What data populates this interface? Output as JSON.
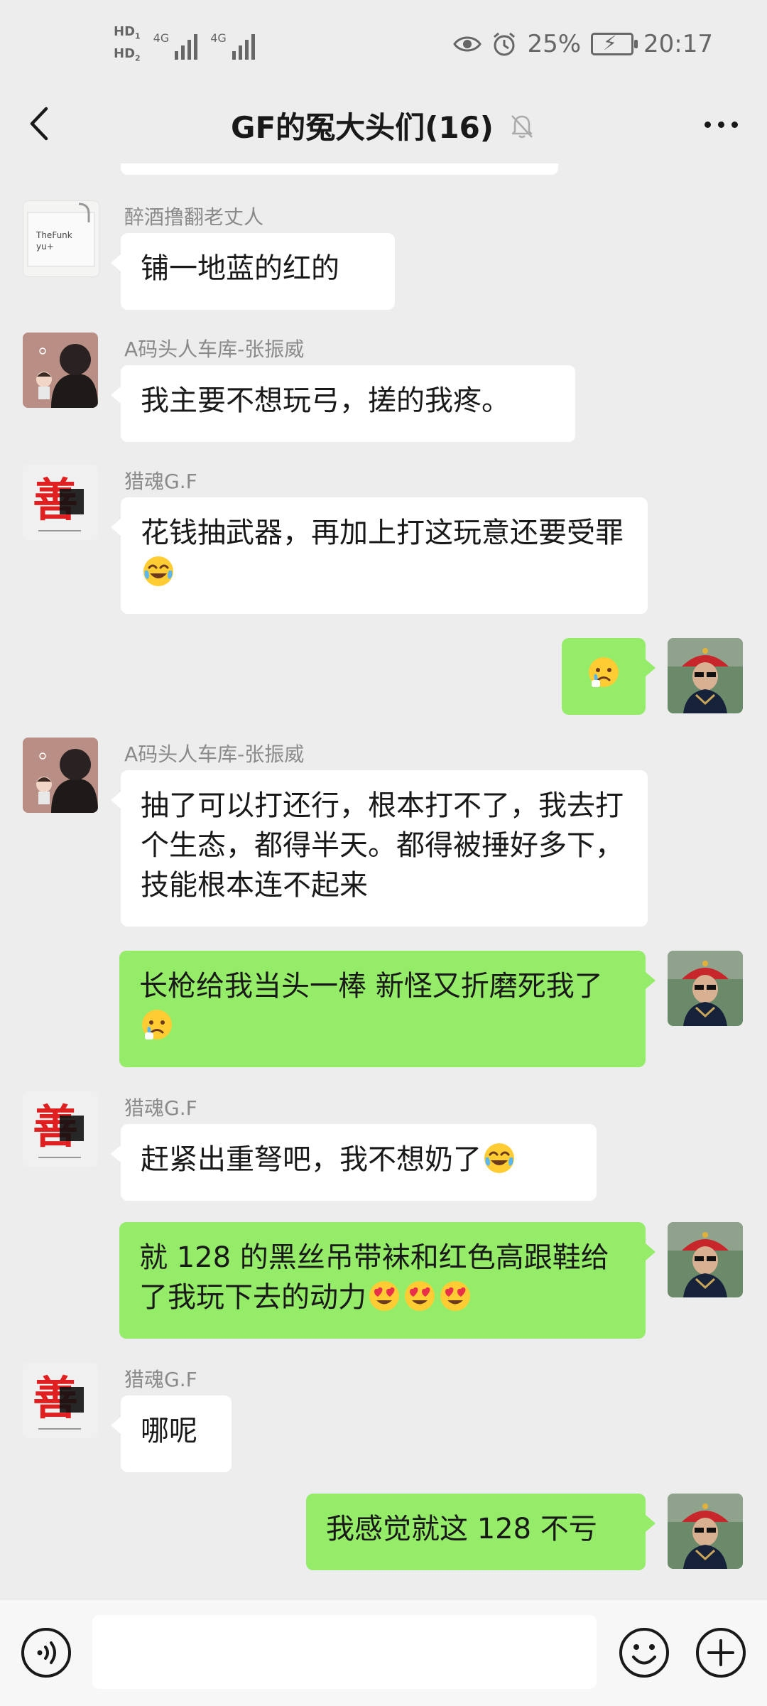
{
  "status_bar": {
    "hd1": "HD",
    "hd1_sub": "1",
    "hd2": "HD",
    "hd2_sub": "2",
    "signal1": "4G",
    "signal2": "4G",
    "battery": "25%",
    "time": "20:17"
  },
  "header": {
    "title": "GF的冤大头们(16)",
    "icons": {
      "back": "chevron-left-icon",
      "mute": "bell-off-icon",
      "more": "more-icon"
    }
  },
  "messages": [
    {
      "side": "in",
      "sender": "醉酒撸翻老丈人",
      "text": "铺一地蓝的红的",
      "avatar": "note-card"
    },
    {
      "side": "in",
      "sender": "A码头人车库-张振威",
      "text": "我主要不想玩弓，搓的我疼。",
      "avatar": "cartoon-man"
    },
    {
      "side": "in",
      "sender": "猎魂G.F",
      "text": "花钱抽武器，再加上打这玩意还要受罪",
      "emoji": "laughing-tears-emoji",
      "avatar": "red-char"
    },
    {
      "side": "out",
      "text": "",
      "emoji": "sad-emoji",
      "avatar": "qing-hat-man"
    },
    {
      "side": "in",
      "sender": "A码头人车库-张振威",
      "text": "抽了可以打还行，根本打不了，我去打个生态，都得半天。都得被捶好多下，技能根本连不起来",
      "avatar": "cartoon-man"
    },
    {
      "side": "out",
      "text": "长枪给我当头一棒 新怪又折磨死我了",
      "emoji": "sad-emoji",
      "avatar": "qing-hat-man"
    },
    {
      "side": "in",
      "sender": "猎魂G.F",
      "text": "赶紧出重弩吧，我不想奶了",
      "emoji": "laughing-tears-emoji",
      "avatar": "red-char"
    },
    {
      "side": "out",
      "text": "就 128 的黑丝吊带袜和红色高跟鞋给了我玩下去的动力",
      "emoji": "heart-eyes-emoji x3",
      "avatar": "qing-hat-man"
    },
    {
      "side": "in",
      "sender": "猎魂G.F",
      "text": "哪呢",
      "avatar": "red-char"
    },
    {
      "side": "out",
      "text": "我感觉就这 128 不亏",
      "avatar": "qing-hat-man"
    }
  ],
  "avatar_labels": {
    "note_line1": "TheFunk",
    "note_line2": "yu+",
    "red_char": "善"
  },
  "input_bar": {
    "placeholder": "",
    "icons": {
      "voice": "voice-icon",
      "emoji": "emoji-icon",
      "plus": "plus-icon"
    }
  },
  "colors": {
    "background": "#EDEDED",
    "bubble_out": "#95EC69",
    "bubble_in": "#FFFFFF",
    "sender_name": "#8A8A8A"
  }
}
